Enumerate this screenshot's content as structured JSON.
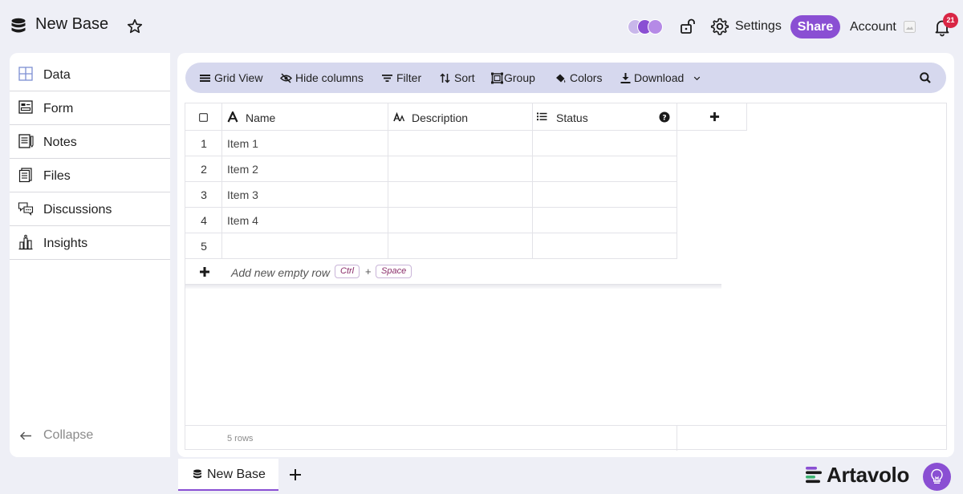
{
  "header": {
    "title": "New Base",
    "settings_label": "Settings",
    "share_label": "Share",
    "account_label": "Account",
    "notifications_count": "21"
  },
  "sidebar": {
    "items": [
      {
        "label": "Data",
        "icon": "grid-icon"
      },
      {
        "label": "Form",
        "icon": "form-icon"
      },
      {
        "label": "Notes",
        "icon": "notes-icon"
      },
      {
        "label": "Files",
        "icon": "files-icon"
      },
      {
        "label": "Discussions",
        "icon": "discussions-icon"
      },
      {
        "label": "Insights",
        "icon": "insights-icon"
      }
    ],
    "collapse_label": "Collapse"
  },
  "toolbar": {
    "grid_view": "Grid View",
    "hide_columns": "Hide columns",
    "filter": "Filter",
    "sort": "Sort",
    "group": "Group",
    "colors": "Colors",
    "download": "Download"
  },
  "grid": {
    "columns": [
      {
        "label": "Name",
        "icon": "text-type-icon"
      },
      {
        "label": "Description",
        "icon": "small-text-icon"
      },
      {
        "label": "Status",
        "icon": "list-icon"
      }
    ],
    "rows": [
      {
        "num": "1",
        "name": "Item 1"
      },
      {
        "num": "2",
        "name": "Item 2"
      },
      {
        "num": "3",
        "name": "Item 3"
      },
      {
        "num": "4",
        "name": "Item 4"
      },
      {
        "num": "5",
        "name": ""
      }
    ],
    "add_row_label": "Add new empty row",
    "shortcut_key1": "Ctrl",
    "shortcut_plus": "+",
    "shortcut_key2": "Space",
    "row_count": "5 rows"
  },
  "bottom": {
    "tab_label": "New Base",
    "brand": "Artavolo"
  },
  "colors": {
    "accent": "#8a4fd3",
    "toolbar_bg": "#d6d8ee",
    "badge": "#d92645"
  }
}
